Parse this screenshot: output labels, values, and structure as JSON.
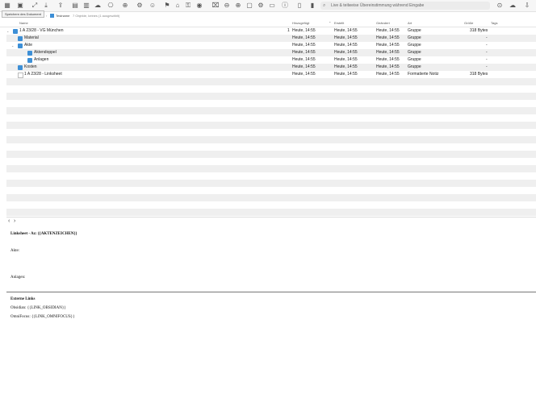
{
  "toolbar": {
    "search_placeholder": "Live & teilweise Übereinstimmung während Eingabe",
    "tooltip": "Speichern des Dokument"
  },
  "pathbar": {
    "crumb1": "Datenbanken",
    "crumb2": "Testname",
    "status": "7 Objekte, keines (1 ausgewählt)"
  },
  "columns": {
    "name": "Name",
    "changed": "Hinzugefügt",
    "created": "Erstellt",
    "modified": "Geändert",
    "kind": "Art",
    "size": "Größe",
    "tags": "Tags"
  },
  "rows": [
    {
      "name": "1 A 23/28 - VG München",
      "count": "1",
      "changed": "Heute, 14:55",
      "created": "Heute, 14:55",
      "modified": "Heute, 14:55",
      "kind": "Gruppe",
      "size": "318 Bytes",
      "indent": "0",
      "icon": "folder",
      "disc": "⌄"
    },
    {
      "name": "Material",
      "count": "",
      "changed": "Heute, 14:55",
      "created": "Heute, 14:55",
      "modified": "Heute, 14:55",
      "kind": "Gruppe",
      "size": "-",
      "indent": "1",
      "icon": "folder",
      "disc": ""
    },
    {
      "name": "Akte",
      "count": "",
      "changed": "Heute, 14:55",
      "created": "Heute, 14:55",
      "modified": "Heute, 14:55",
      "kind": "Gruppe",
      "size": "-",
      "indent": "1",
      "icon": "folder",
      "disc": "⌄"
    },
    {
      "name": "Aktendoppel",
      "count": "",
      "changed": "Heute, 14:55",
      "created": "Heute, 14:55",
      "modified": "Heute, 14:55",
      "kind": "Gruppe",
      "size": "-",
      "indent": "2",
      "icon": "folder",
      "disc": ""
    },
    {
      "name": "Anlagen",
      "count": "",
      "changed": "Heute, 14:55",
      "created": "Heute, 14:55",
      "modified": "Heute, 14:55",
      "kind": "Gruppe",
      "size": "-",
      "indent": "2",
      "icon": "folder",
      "disc": ""
    },
    {
      "name": "Kosten",
      "count": "",
      "changed": "Heute, 14:55",
      "created": "Heute, 14:55",
      "modified": "Heute, 14:55",
      "kind": "Gruppe",
      "size": "-",
      "indent": "1",
      "icon": "folder",
      "disc": ""
    },
    {
      "name": "1 A 23/28 - Linksheet",
      "count": "",
      "changed": "Heute, 14:55",
      "created": "Heute, 14:55",
      "modified": "Heute, 14:55",
      "kind": "Formatierte Notiz",
      "size": "318 Bytes",
      "indent": "1",
      "icon": "doc",
      "disc": ""
    }
  ],
  "nav": {
    "back": "‹",
    "forward": "›"
  },
  "preview": {
    "title": "Linksheet - Az: {{AKTENZEICHEN}}",
    "akte": "Akte:",
    "anlagen": "Anlagen:",
    "external_heading": "Externe Links",
    "obsidian": "Obsidian: {{LINK_OBSIDIAN}}",
    "omnifocus": "OmniFocus: {{LINK_OMNIFOCUS}}"
  }
}
